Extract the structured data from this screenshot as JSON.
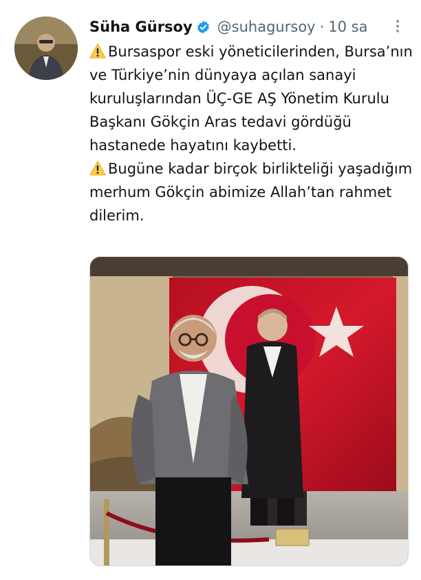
{
  "tweet": {
    "display_name": "Süha Gürsoy",
    "handle": "@suhagursoy",
    "separator": "·",
    "time": "10 sa",
    "paragraphs": [
      "Bursaspor eski yöneticilerinden, Bursa’nın ve Türkiye’nin dünyaya açılan sanayi kuruluşlarından ÜÇ-GE AŞ Yönetim Kurulu Başkanı Gökçin Aras tedavi gördüğü hastanede hayatını kaybetti.",
      "Bugüne kadar birçok birlikteliği yaşadığım merhum Gökçin abimize Allah’tan rahmet dilerim."
    ],
    "icons": {
      "verified": "verified-badge-icon",
      "warning": "warning-sign-icon",
      "more": "more-options-icon"
    }
  },
  "colors": {
    "verified_blue": "#1d9bf0",
    "muted_text": "#536471",
    "flag_red": "#c8102e",
    "warning_yellow": "#ffcc4d"
  }
}
